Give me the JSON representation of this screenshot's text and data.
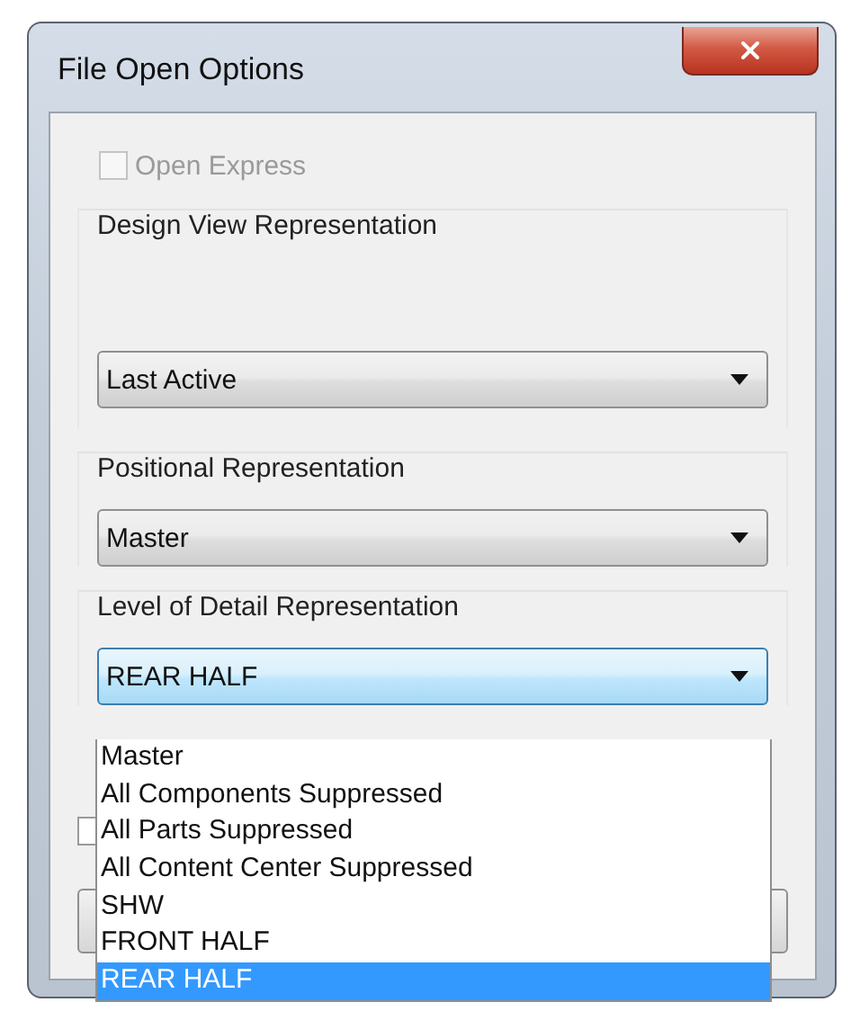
{
  "window": {
    "title": "File Open Options"
  },
  "open_express": {
    "label": "Open Express",
    "checked": false,
    "disabled": true
  },
  "groups": [
    {
      "label": "Design View Representation",
      "value": "Last Active",
      "focused": false
    },
    {
      "label": "Positional Representation",
      "value": "Master",
      "focused": false
    },
    {
      "label": "Level of Detail Representation",
      "value": "REAR HALF",
      "focused": true
    }
  ],
  "dropdown": {
    "items": [
      {
        "label": "Master",
        "selected": false
      },
      {
        "label": "All Components Suppressed",
        "selected": false
      },
      {
        "label": "All Parts Suppressed",
        "selected": false
      },
      {
        "label": "All Content Center Suppressed",
        "selected": false
      },
      {
        "label": "SHW",
        "selected": false
      },
      {
        "label": "FRONT HALF",
        "selected": false
      },
      {
        "label": "REAR HALF",
        "selected": true
      }
    ]
  }
}
